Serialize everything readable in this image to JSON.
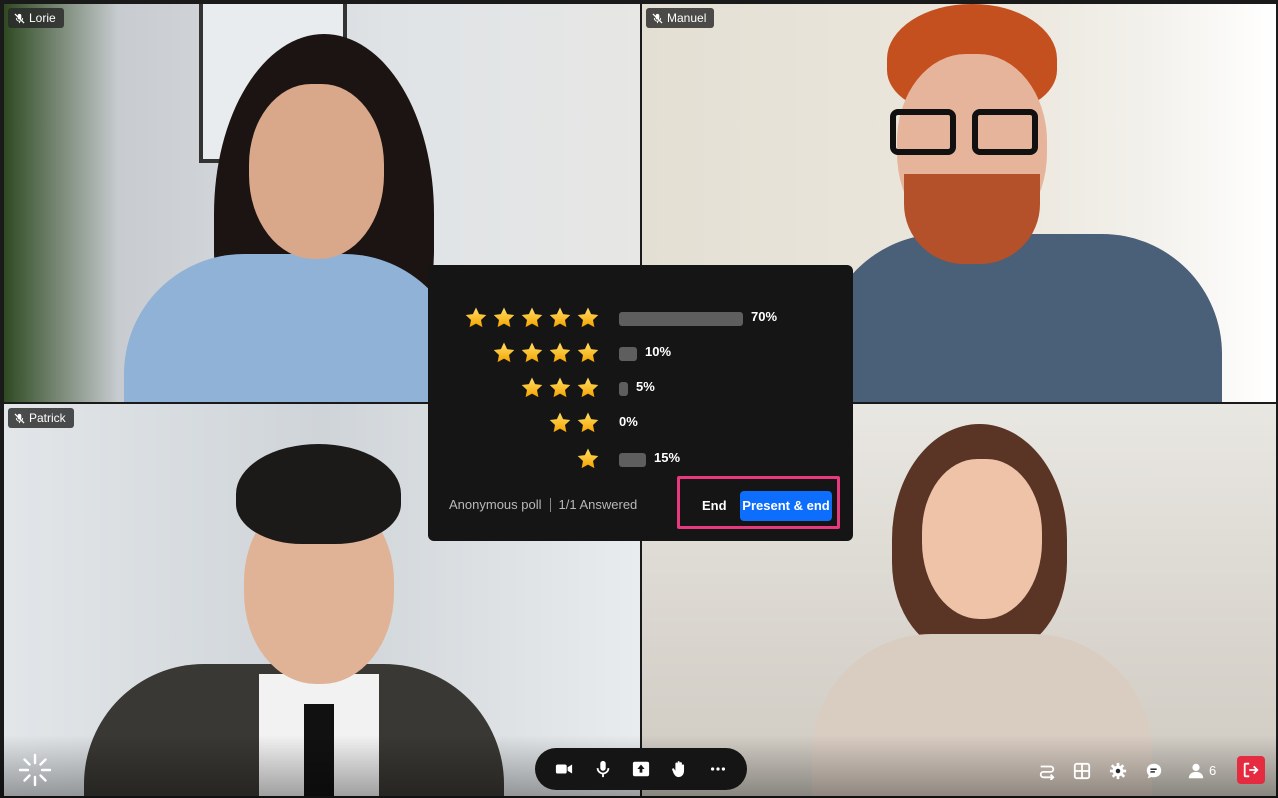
{
  "participants": [
    {
      "name": "Lorie"
    },
    {
      "name": "Manuel"
    },
    {
      "name": "Patrick"
    }
  ],
  "poll": {
    "rows": [
      {
        "stars": 5,
        "percent": 70,
        "label": "70%"
      },
      {
        "stars": 4,
        "percent": 10,
        "label": "10%"
      },
      {
        "stars": 3,
        "percent": 5,
        "label": "5%"
      },
      {
        "stars": 2,
        "percent": 0,
        "label": "0%"
      },
      {
        "stars": 1,
        "percent": 15,
        "label": "15%"
      }
    ],
    "type_label": "Anonymous poll",
    "answered_label": "1/1 Answered",
    "end_label": "End",
    "present_end_label": "Present & end",
    "highlight_color": "#e8387e",
    "accent_color": "#0d6efd"
  },
  "controls": {
    "center": [
      "video-camera-icon",
      "microphone-icon",
      "share-screen-icon",
      "raise-hand-icon",
      "more-options-icon"
    ],
    "right": [
      "switch-view-icon",
      "grid-layout-icon",
      "settings-gear-icon",
      "chat-icon",
      "participants-icon"
    ],
    "participant_count": "6",
    "leave_color": "#e52b3f"
  }
}
